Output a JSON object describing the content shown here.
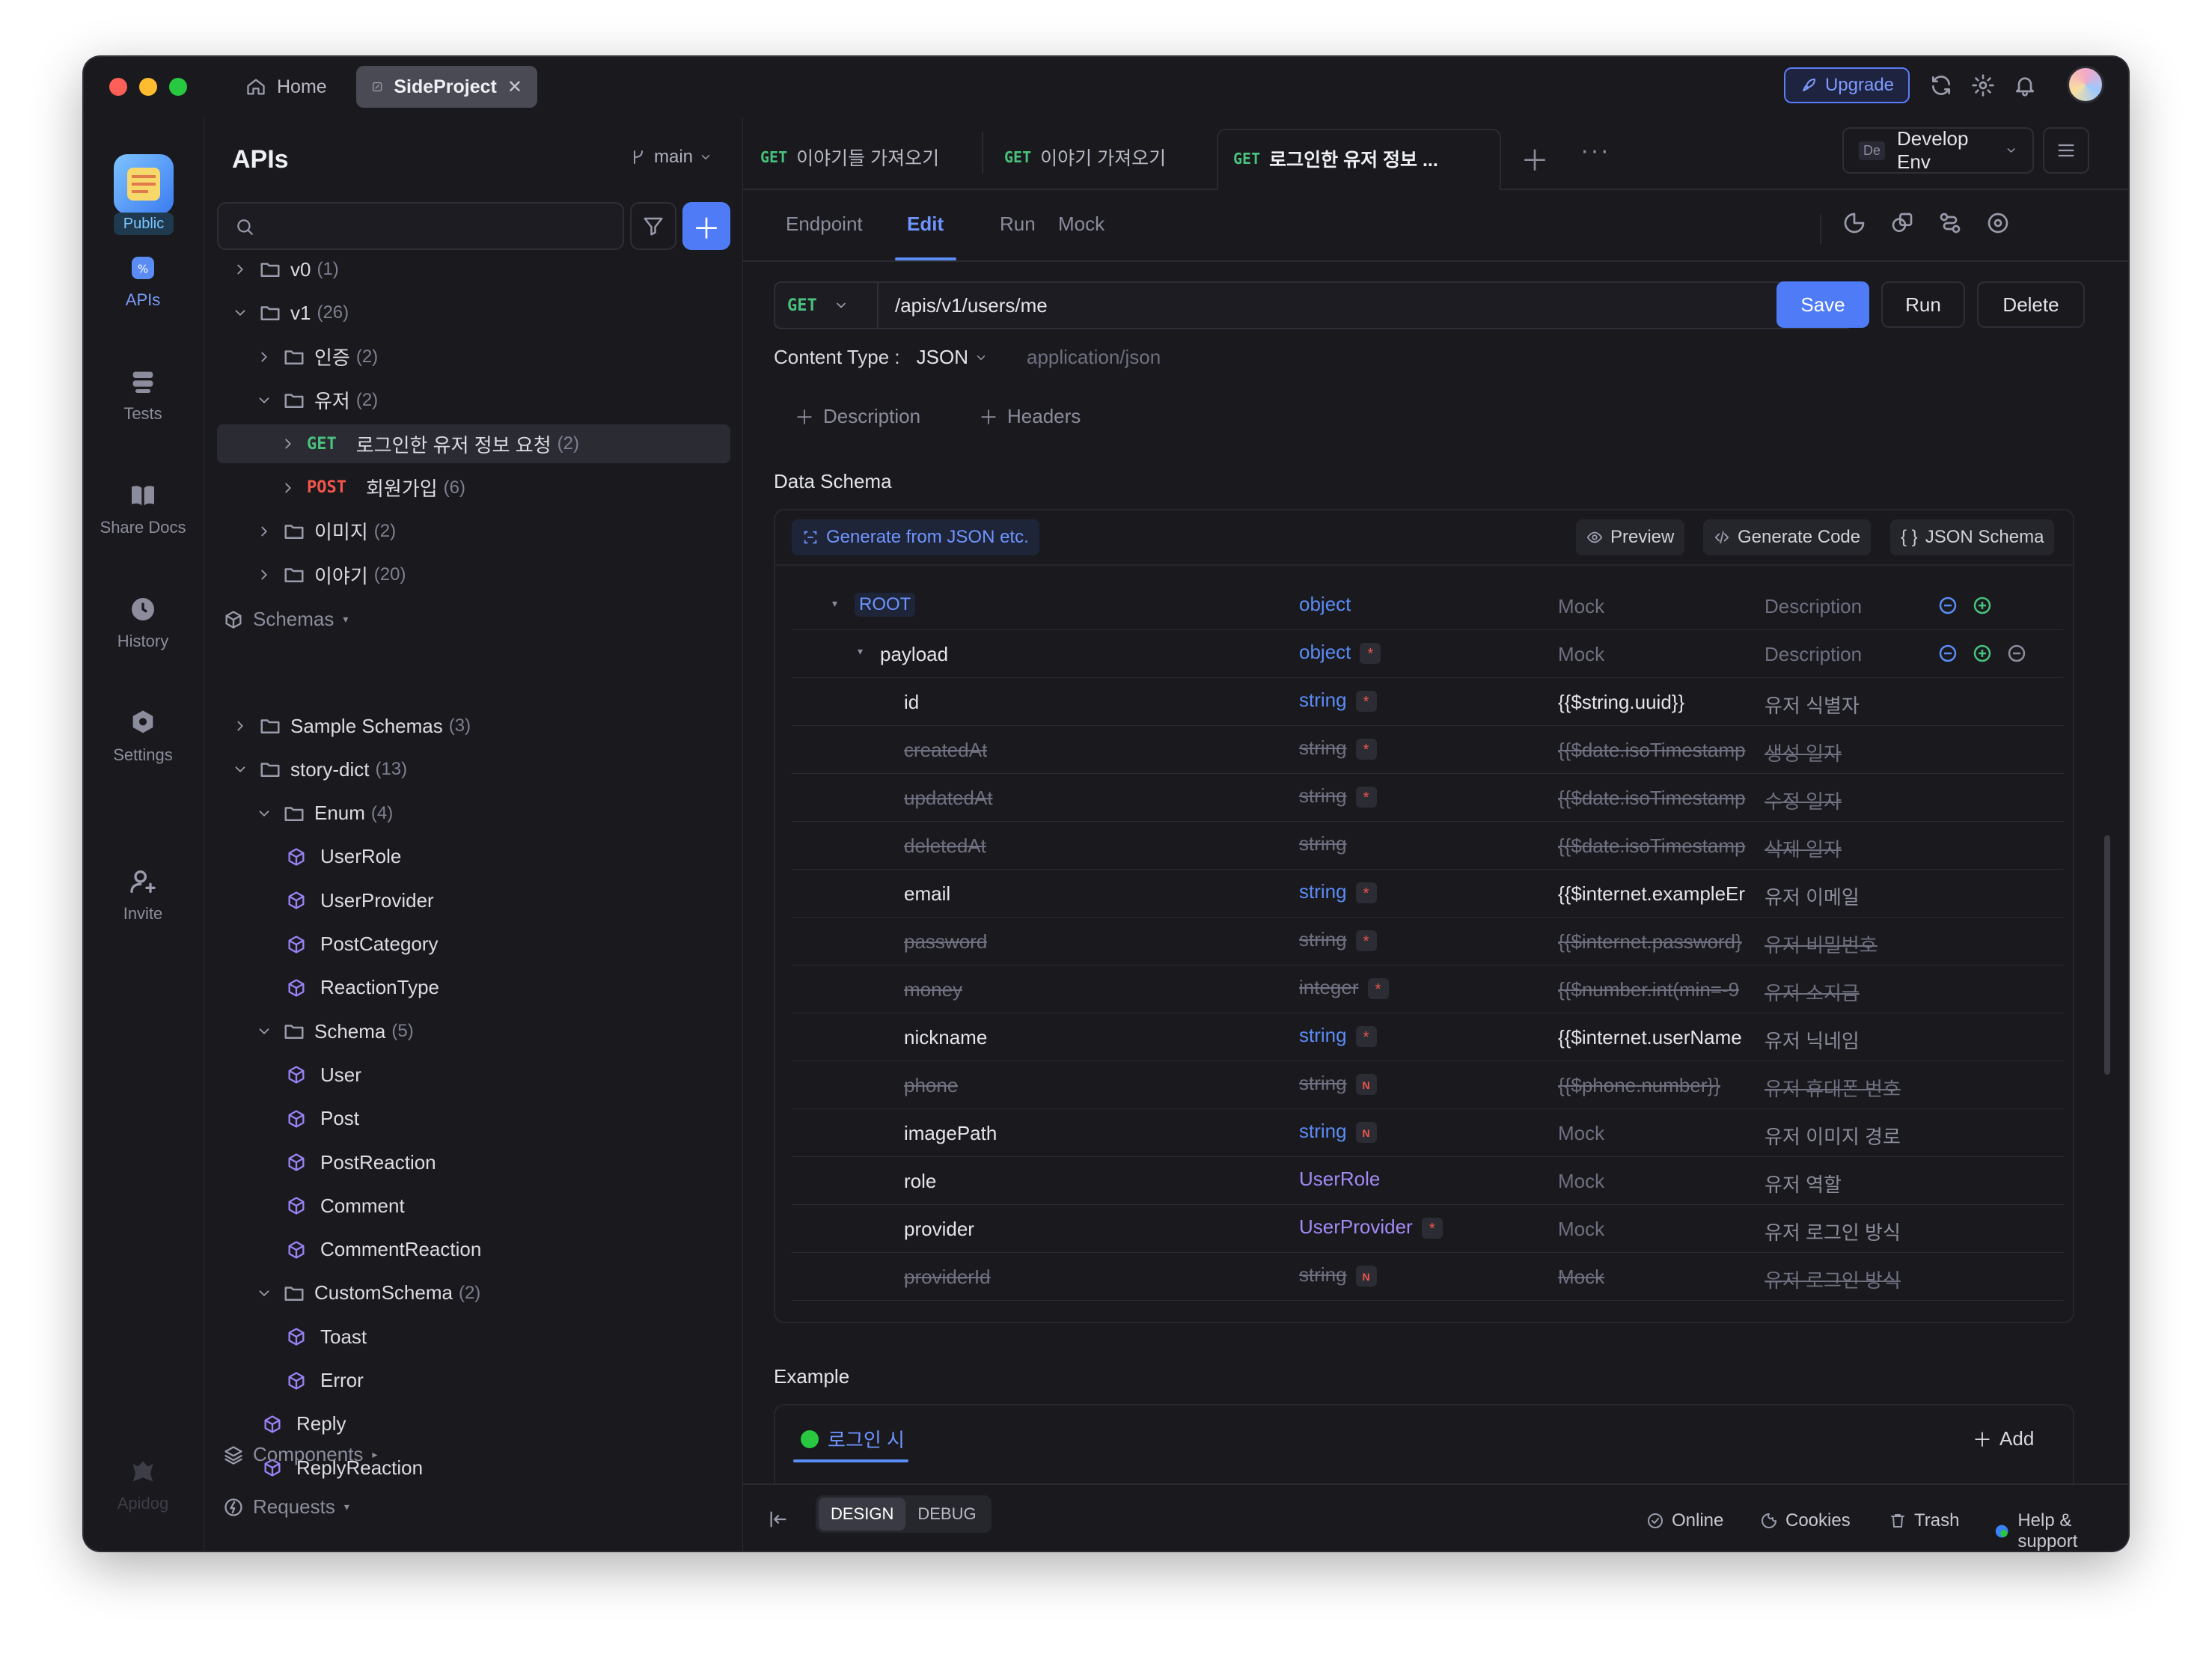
{
  "window": {
    "tabs": {
      "home": "Home",
      "project": "SideProject"
    },
    "header": {
      "upgrade": "Upgrade"
    }
  },
  "rail": {
    "public_badge": "Public",
    "items": [
      {
        "label": "APIs",
        "icon": "apis-icon"
      },
      {
        "label": "Tests",
        "icon": "tests-icon"
      },
      {
        "label": "Share Docs",
        "icon": "book-icon"
      },
      {
        "label": "History",
        "icon": "clock-icon"
      },
      {
        "label": "Settings",
        "icon": "gear-icon"
      },
      {
        "label": "Invite",
        "icon": "person-add-icon"
      }
    ],
    "logo": "Apidog"
  },
  "sidebar": {
    "title": "APIs",
    "branch": "main",
    "tree": [
      {
        "label": "v0",
        "count": "(1)",
        "kind": "folder",
        "depth": 1,
        "open": false
      },
      {
        "label": "v1",
        "count": "(26)",
        "kind": "folder",
        "depth": 1,
        "open": true
      },
      {
        "label": "인증",
        "count": "(2)",
        "kind": "folder",
        "depth": 2,
        "open": false
      },
      {
        "label": "유저",
        "count": "(2)",
        "kind": "folder",
        "depth": 2,
        "open": true
      },
      {
        "method": "GET",
        "label": "로그인한 유저 정보 요청",
        "count": "(2)",
        "kind": "endpoint",
        "depth": 3,
        "selected": true
      },
      {
        "method": "POST",
        "label": "회원가입",
        "count": "(6)",
        "kind": "endpoint",
        "depth": 3
      },
      {
        "label": "이미지",
        "count": "(2)",
        "kind": "folder",
        "depth": 2,
        "open": false
      },
      {
        "label": "이야기",
        "count": "(20)",
        "kind": "folder",
        "depth": 2,
        "open": false
      }
    ],
    "schemas_label": "Schemas",
    "schemas": [
      {
        "label": "Sample Schemas",
        "count": "(3)",
        "kind": "folder",
        "depth": 1,
        "open": false
      },
      {
        "label": "story-dict",
        "count": "(13)",
        "kind": "folder",
        "depth": 1,
        "open": true
      },
      {
        "label": "Enum",
        "count": "(4)",
        "kind": "folder",
        "depth": 2,
        "open": true
      },
      {
        "label": "UserRole",
        "kind": "schema",
        "depth": 3
      },
      {
        "label": "UserProvider",
        "kind": "schema",
        "depth": 3
      },
      {
        "label": "PostCategory",
        "kind": "schema",
        "depth": 3
      },
      {
        "label": "ReactionType",
        "kind": "schema",
        "depth": 3
      },
      {
        "label": "Schema",
        "count": "(5)",
        "kind": "folder",
        "depth": 2,
        "open": true
      },
      {
        "label": "User",
        "kind": "schema",
        "depth": 3
      },
      {
        "label": "Post",
        "kind": "schema",
        "depth": 3
      },
      {
        "label": "PostReaction",
        "kind": "schema",
        "depth": 3
      },
      {
        "label": "Comment",
        "kind": "schema",
        "depth": 3
      },
      {
        "label": "CommentReaction",
        "kind": "schema",
        "depth": 3
      },
      {
        "label": "CustomSchema",
        "count": "(2)",
        "kind": "folder",
        "depth": 2,
        "open": true
      },
      {
        "label": "Toast",
        "kind": "schema",
        "depth": 3
      },
      {
        "label": "Error",
        "kind": "schema",
        "depth": 3
      },
      {
        "label": "Reply",
        "kind": "schema",
        "depth": 2
      },
      {
        "label": "ReplyReaction",
        "kind": "schema",
        "depth": 2
      }
    ],
    "components_label": "Components",
    "requests_label": "Requests"
  },
  "tabs": [
    {
      "method": "GET",
      "label": "이야기들 가져오기"
    },
    {
      "method": "GET",
      "label": "이야기 가져오기"
    },
    {
      "method": "GET",
      "label": "로그인한 유저 정보 ..."
    }
  ],
  "env": {
    "badge": "De",
    "label": "Develop Env"
  },
  "subtabs": [
    "Endpoint",
    "Edit",
    "Run",
    "Mock"
  ],
  "request": {
    "method": "GET",
    "url": "/apis/v1/users/me",
    "save": "Save",
    "run": "Run",
    "delete": "Delete"
  },
  "content_type": {
    "label": "Content Type :",
    "value": "JSON",
    "mime": "application/json"
  },
  "extras": {
    "description": "Description",
    "headers": "Headers"
  },
  "data_schema": {
    "title": "Data Schema",
    "generate": "Generate from JSON etc.",
    "preview": "Preview",
    "generate_code": "Generate Code",
    "json_schema": "JSON Schema",
    "rows": [
      {
        "name": "ROOT",
        "type": "object",
        "mock": "Mock",
        "desc": "Description",
        "depth": 0,
        "root": true
      },
      {
        "name": "payload",
        "type": "object",
        "req": "*",
        "mock": "Mock",
        "desc": "Description",
        "depth": 1
      },
      {
        "name": "id",
        "type": "string",
        "req": "*",
        "mock": "{{$string.uuid}}",
        "desc": "유저 식별자",
        "depth": 2
      },
      {
        "name": "createdAt",
        "type": "string",
        "req": "*",
        "mock": "{{$date.isoTimestamp",
        "desc": "생성 일자",
        "depth": 2,
        "deprecated": true
      },
      {
        "name": "updatedAt",
        "type": "string",
        "req": "*",
        "mock": "{{$date.isoTimestamp",
        "desc": "수정 일자",
        "depth": 2,
        "deprecated": true
      },
      {
        "name": "deletedAt",
        "type": "string",
        "mock": "{{$date.isoTimestamp",
        "desc": "삭제 일자",
        "depth": 2,
        "deprecated": true
      },
      {
        "name": "email",
        "type": "string",
        "req": "*",
        "mock": "{{$internet.exampleEr",
        "desc": "유저 이메일",
        "depth": 2
      },
      {
        "name": "password",
        "type": "string",
        "req": "*",
        "mock": "{{$internet.password}",
        "desc": "유저 비밀번호",
        "depth": 2,
        "deprecated": true
      },
      {
        "name": "money",
        "type": "integer",
        "req": "*",
        "mock": "{{$number.int(min=-9",
        "desc": "유저 소지금",
        "depth": 2,
        "deprecated": true
      },
      {
        "name": "nickname",
        "type": "string",
        "req": "*",
        "mock": "{{$internet.userName",
        "desc": "유저 닉네임",
        "depth": 2
      },
      {
        "name": "phone",
        "type": "string",
        "req": "N",
        "mock": "{{$phone.number}}",
        "desc": "유저 휴대폰 번호",
        "depth": 2,
        "deprecated": true
      },
      {
        "name": "imagePath",
        "type": "string",
        "req": "N",
        "mock": "Mock",
        "desc": "유저 이미지 경로",
        "depth": 2
      },
      {
        "name": "role",
        "type": "UserRole",
        "mock": "Mock",
        "desc": "유저 역할",
        "depth": 2,
        "ref": true
      },
      {
        "name": "provider",
        "type": "UserProvider",
        "req": "*",
        "mock": "Mock",
        "desc": "유저 로그인 방식",
        "depth": 2,
        "ref": true
      },
      {
        "name": "providerId",
        "type": "string",
        "req": "N",
        "mock": "Mock",
        "desc": "유저 로그인 방식",
        "depth": 2,
        "deprecated": true
      }
    ]
  },
  "example": {
    "title": "Example",
    "tab": "로그인 시",
    "add": "Add"
  },
  "footer": {
    "design": "DESIGN",
    "debug": "DEBUG",
    "online": "Online",
    "cookies": "Cookies",
    "trash": "Trash",
    "help": "Help & support"
  },
  "colors": {
    "accent": "#4f7cf6",
    "get": "#49c27d",
    "post": "#f2564b",
    "type": "#5b8cf5",
    "ref": "#a48af5"
  }
}
